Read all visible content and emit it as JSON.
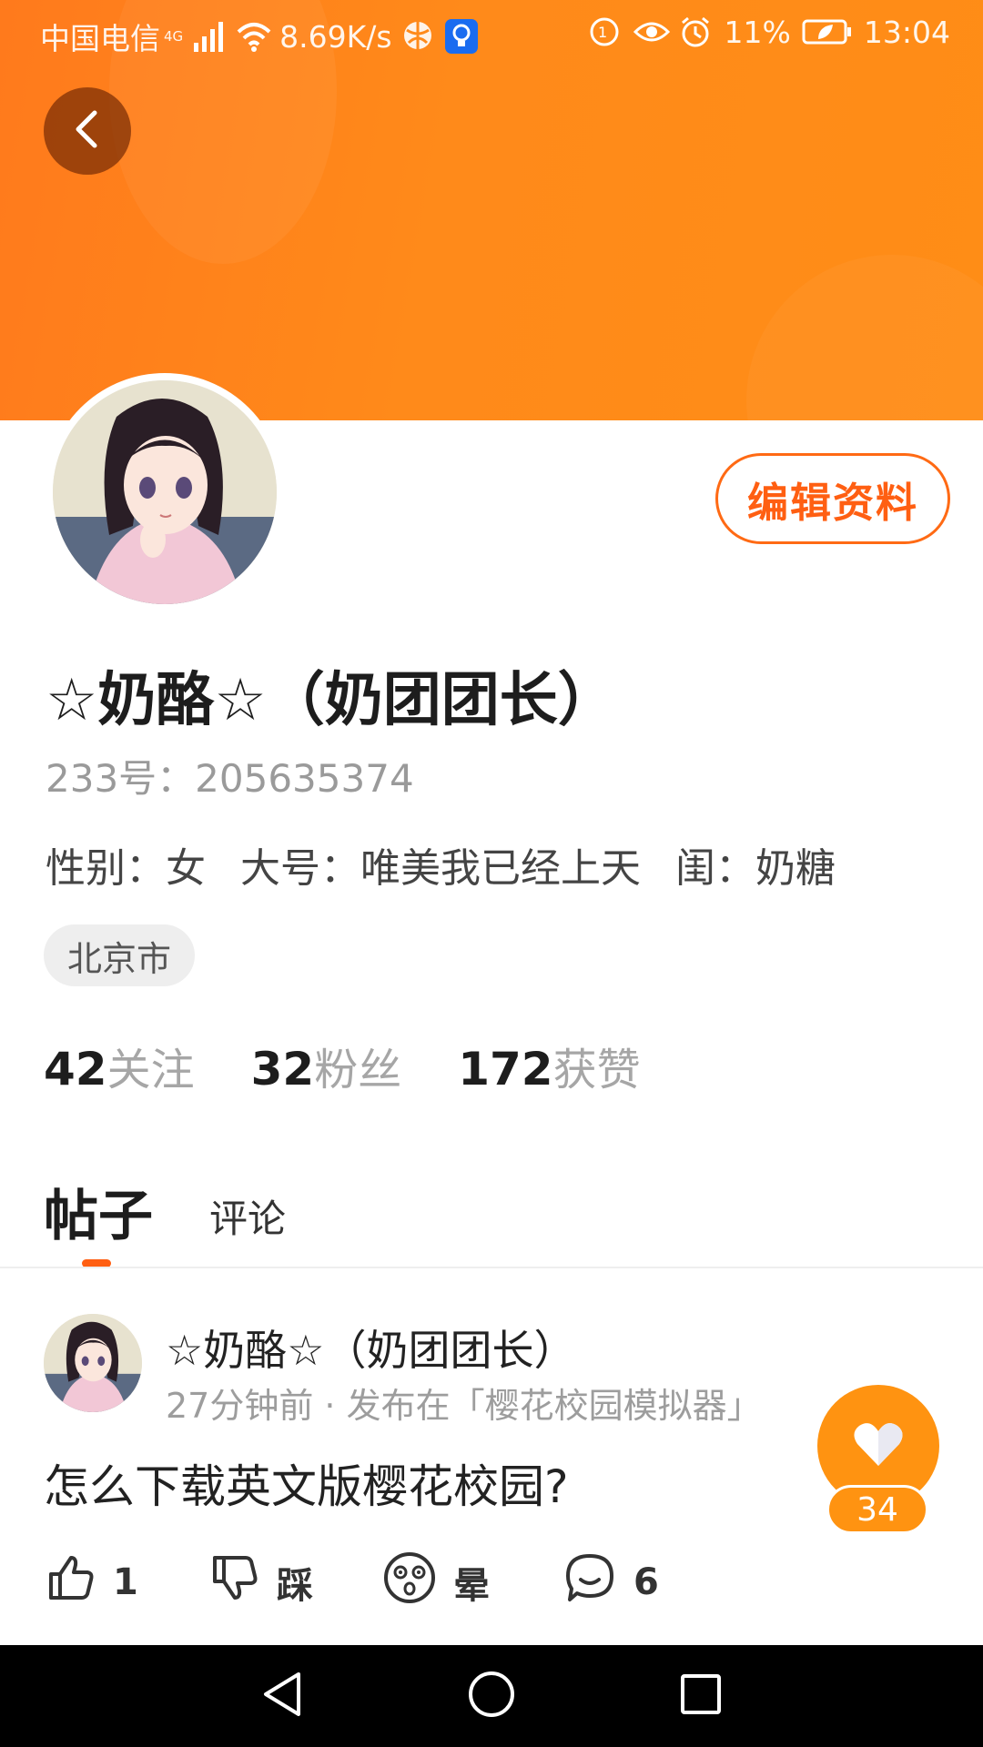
{
  "status_bar": {
    "carrier": "中国电信",
    "network": "4G",
    "speed": "8.69K/s",
    "battery": "11%",
    "time": "13:04"
  },
  "profile": {
    "nickname": "☆奶酪☆（奶团团长）",
    "account": "233号：205635374",
    "meta": [
      {
        "label": "性别：",
        "value": "女"
      },
      {
        "label": "大号：",
        "value": "唯美我已经上天"
      },
      {
        "label": "闺：",
        "value": "奶糖"
      }
    ],
    "location": "北京市",
    "edit_label": "编辑资料",
    "stats": [
      {
        "num": "42",
        "label": "关注"
      },
      {
        "num": "32",
        "label": "粉丝"
      },
      {
        "num": "172",
        "label": "获赞"
      }
    ]
  },
  "tabs": {
    "posts": "帖子",
    "comments": "评论"
  },
  "post": {
    "author": "☆奶酪☆（奶团团长）",
    "time_source": "27分钟前 · 发布在「樱花校园模拟器」",
    "title": "怎么下载英文版樱花校园?",
    "actions": {
      "like": "1",
      "dislike": "踩",
      "dizzy": "晕",
      "comment": "6"
    }
  },
  "fab": {
    "count": "34"
  },
  "colors": {
    "accent": "#ff5f12",
    "banner": "#ff8316",
    "fab": "#ff9311"
  }
}
